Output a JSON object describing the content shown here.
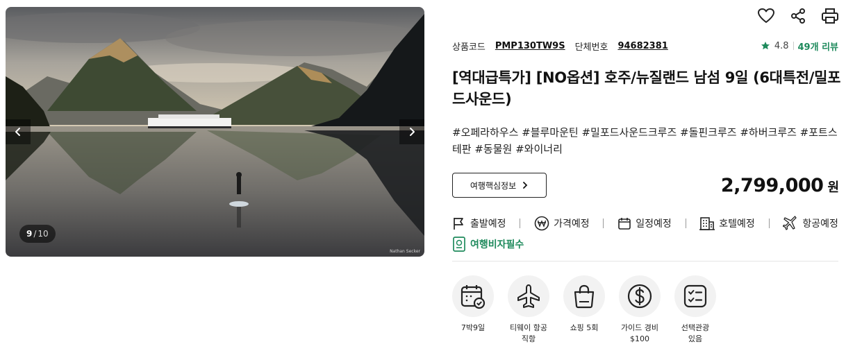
{
  "gallery": {
    "current": "9",
    "total": "10",
    "separator": "/",
    "credit": "Nathan Secker"
  },
  "actions": [
    "heart-icon",
    "share-icon",
    "print-icon"
  ],
  "product": {
    "code_label": "상품코드",
    "code": "PMP130TW9S",
    "group_label": "단체번호",
    "group": "94682381",
    "rating": "4.8",
    "reviews": "49개 리뷰",
    "title": "[역대급특가] [NO옵션] 호주/뉴질랜드 남섬 9일 (6대특전/밀포드사운드)",
    "tags": "#오페라하우스 #블루마운틴 #밀포드사운드크루즈 #돌핀크루즈 #하버크루즈 #포트스테판 #동물원 #와이너리",
    "core_info_button": "여행핵심정보",
    "price": "2,799,000",
    "price_unit": "원"
  },
  "statuses": [
    {
      "label": "출발예정",
      "icon": "flag-icon"
    },
    {
      "label": "가격예정",
      "icon": "won-icon"
    },
    {
      "label": "일정예정",
      "icon": "calendar-icon"
    },
    {
      "label": "호텔예정",
      "icon": "hotel-icon"
    },
    {
      "label": "항공예정",
      "icon": "airplane-icon"
    }
  ],
  "visa_label": "여행비자필수",
  "features": [
    {
      "label": "7박9일",
      "icon": "calendar-check-icon"
    },
    {
      "label": "티웨이 항공\n직항",
      "icon": "airplane-icon"
    },
    {
      "label": "쇼핑 5회",
      "icon": "shopping-bag-icon"
    },
    {
      "label": "가이드 경비\n$100",
      "icon": "dollar-icon"
    },
    {
      "label": "선택관광\n있음",
      "icon": "checklist-icon"
    }
  ],
  "colors": {
    "accent": "#1e8a5c",
    "star": "#1e8a5c"
  }
}
